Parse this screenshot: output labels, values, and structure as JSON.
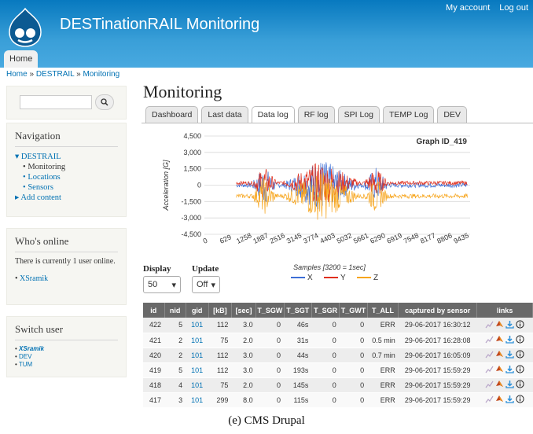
{
  "header": {
    "site_name": "DESTinationRAIL Monitoring",
    "secondary_menu": [
      "My account",
      "Log out"
    ],
    "main_tab": "Home"
  },
  "breadcrumb": [
    "Home",
    "DESTRAIL",
    "Monitoring"
  ],
  "breadcrumb_sep": "»",
  "sidebar": {
    "nav_title": "Navigation",
    "nav": {
      "destrail": "DESTRAIL",
      "monitoring": "Monitoring",
      "locations": "Locations",
      "sensors": "Sensors",
      "add_content": "Add content"
    },
    "online_title": "Who's online",
    "online_text": "There is currently 1 user online.",
    "online_user": "XSramik",
    "switch_title": "Switch user",
    "switch_users": [
      "XSramik",
      "DEV",
      "TUM"
    ]
  },
  "main": {
    "title": "Monitoring",
    "tabs": [
      "Dashboard",
      "Last data",
      "Data log",
      "RF log",
      "SPI Log",
      "TEMP Log",
      "DEV"
    ],
    "active_tab": "Data log",
    "display_label": "Display",
    "display_value": "50",
    "update_label": "Update",
    "update_value": "Off"
  },
  "chart_data": {
    "type": "line",
    "title": "Graph ID_419",
    "ylabel": "Acceleration [G]",
    "xlabel": "Samples [3200 = 1sec]",
    "y_ticks": [
      "4,500",
      "3,000",
      "1,500",
      "0",
      "-1,500",
      "-3,000",
      "-4,500"
    ],
    "ylim": [
      -4500,
      4500
    ],
    "x_ticks": [
      "0",
      "629",
      "1258",
      "1887",
      "2516",
      "3145",
      "3774",
      "4403",
      "5032",
      "5661",
      "6290",
      "6919",
      "7548",
      "8177",
      "8806",
      "9435"
    ],
    "xlim": [
      0,
      10000
    ],
    "grid": true,
    "legend_position": "bottom",
    "series": [
      {
        "name": "X",
        "color": "#3d6fd6",
        "baseline": 0
      },
      {
        "name": "Y",
        "color": "#e0301e",
        "baseline": 200
      },
      {
        "name": "Z",
        "color": "#f7a51c",
        "baseline": -1000
      }
    ]
  },
  "table": {
    "headers": [
      "id",
      "nid",
      "gid",
      "[kB]",
      "[sec]",
      "T_SGW",
      "T_SGT",
      "T_SGR",
      "T_GWT",
      "T_ALL",
      "captured by sensor",
      "links"
    ],
    "rows": [
      [
        "422",
        "5",
        "101",
        "112",
        "3.0",
        "0",
        "46s",
        "0",
        "0",
        "ERR",
        "29-06-2017 16:30:12"
      ],
      [
        "421",
        "2",
        "101",
        "75",
        "2.0",
        "0",
        "31s",
        "0",
        "0",
        "0.5 min",
        "29-06-2017 16:28:08"
      ],
      [
        "420",
        "2",
        "101",
        "112",
        "3.0",
        "0",
        "44s",
        "0",
        "0",
        "0.7 min",
        "29-06-2017 16:05:09"
      ],
      [
        "419",
        "5",
        "101",
        "112",
        "3.0",
        "0",
        "193s",
        "0",
        "0",
        "ERR",
        "29-06-2017 15:59:29"
      ],
      [
        "418",
        "4",
        "101",
        "75",
        "2.0",
        "0",
        "145s",
        "0",
        "0",
        "ERR",
        "29-06-2017 15:59:29"
      ],
      [
        "417",
        "3",
        "101",
        "299",
        "8.0",
        "0",
        "115s",
        "0",
        "0",
        "ERR",
        "29-06-2017 15:59:29"
      ]
    ]
  },
  "caption": "(e) CMS Drupal"
}
